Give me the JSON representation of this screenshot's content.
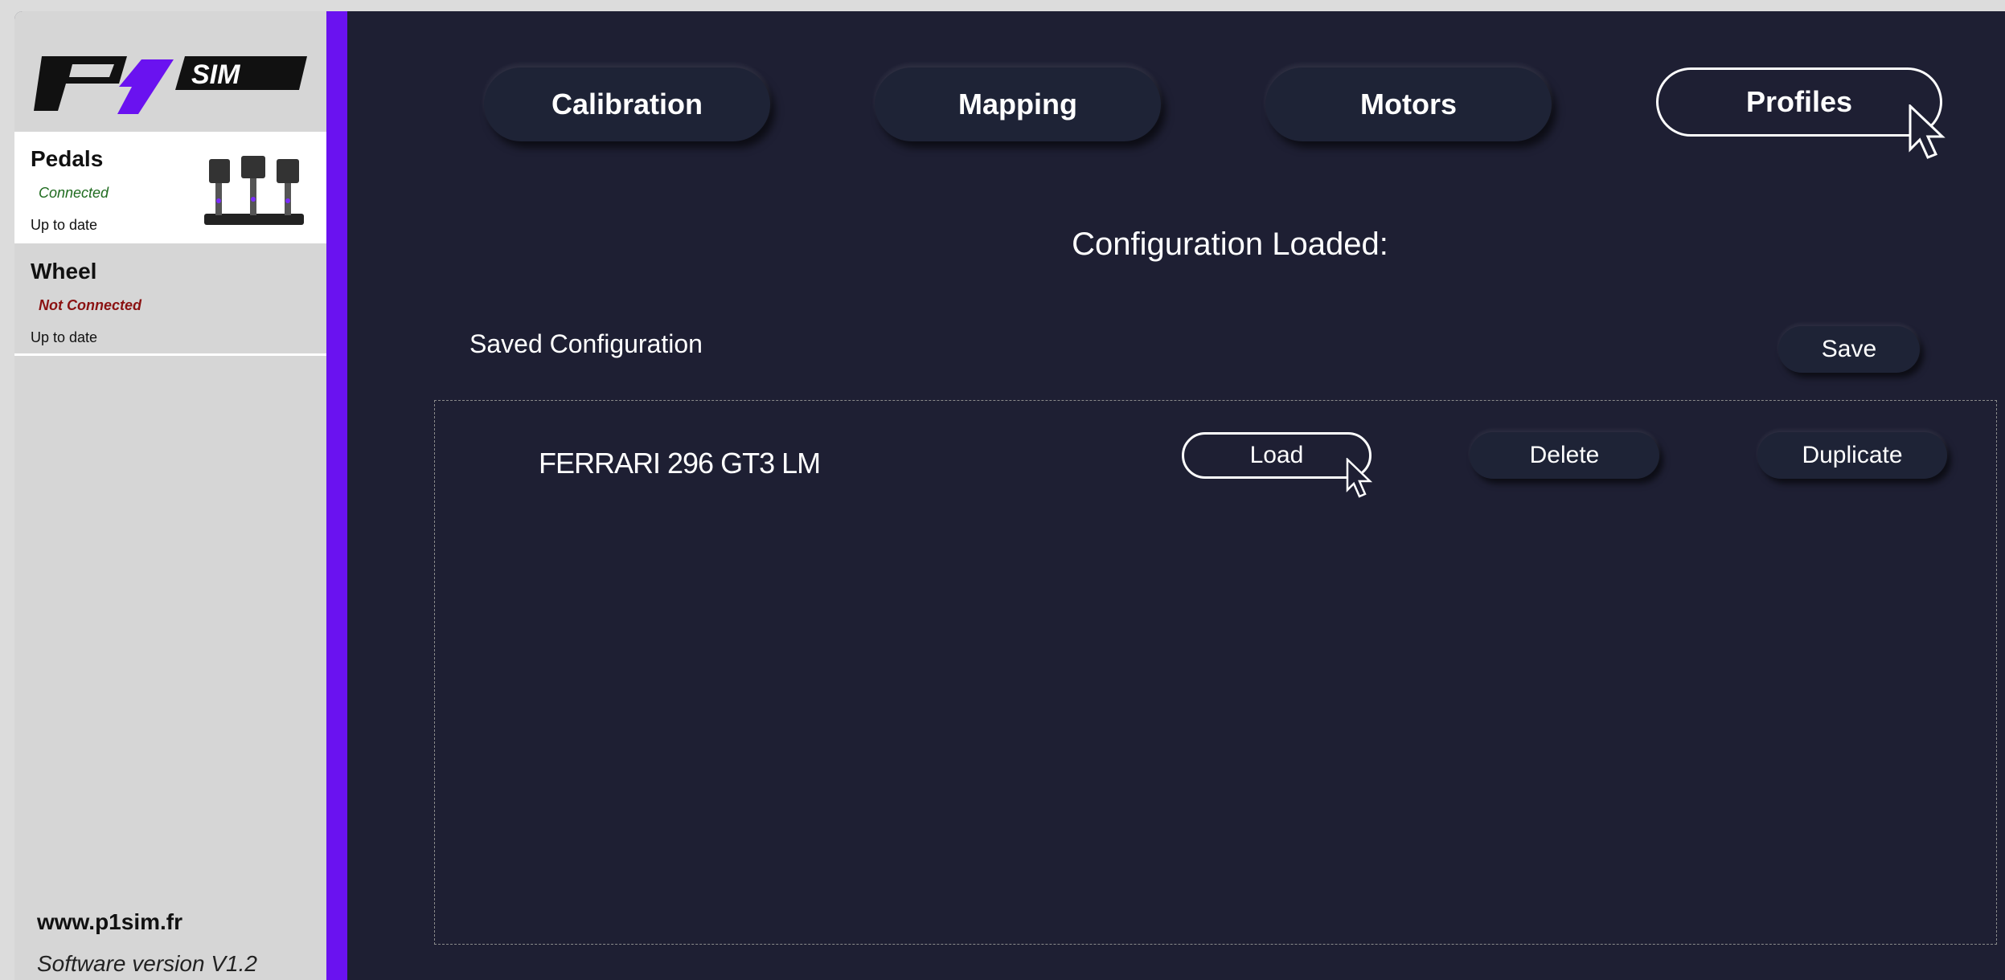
{
  "app": {
    "logo_text": "P1 SIM",
    "accent_color": "#6a12f0",
    "background_color": "#1e1f33"
  },
  "sidebar": {
    "devices": [
      {
        "name": "Pedals",
        "status": "Connected",
        "status_color": "#1f6b1f",
        "update": "Up to date",
        "icon": "pedals-image"
      },
      {
        "name": "Wheel",
        "status": "Not Connected",
        "status_color": "#8b1212",
        "update": "Up to date"
      }
    ],
    "website": "www.p1sim.fr",
    "version": "Software version V1.2"
  },
  "tabs": [
    {
      "label": "Calibration",
      "active": false
    },
    {
      "label": "Mapping",
      "active": false
    },
    {
      "label": "Motors",
      "active": false
    },
    {
      "label": "Profiles",
      "active": true
    }
  ],
  "main": {
    "loaded_title": "Configuration Loaded:",
    "saved_label": "Saved Configuration",
    "save_label": "Save",
    "profiles": [
      {
        "name": "FERRARI 296 GT3 LM",
        "load_label": "Load",
        "delete_label": "Delete",
        "duplicate_label": "Duplicate"
      }
    ]
  }
}
